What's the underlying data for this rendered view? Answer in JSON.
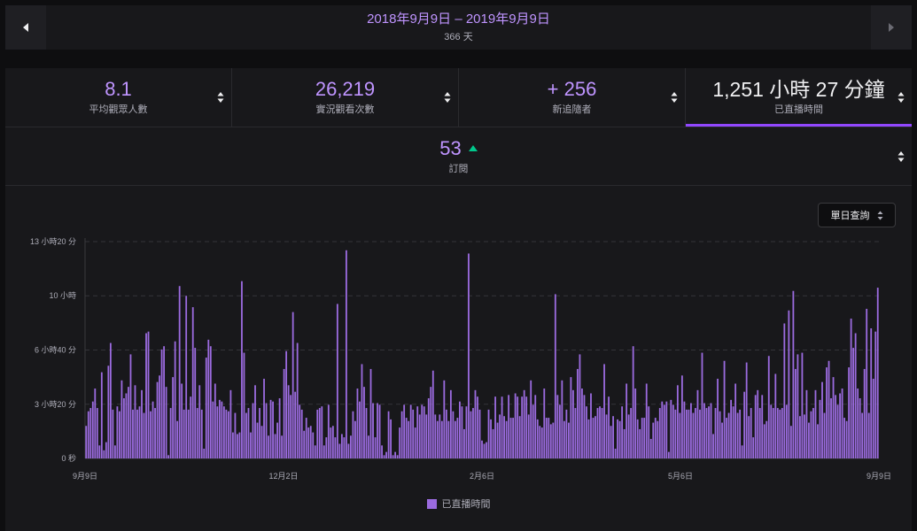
{
  "date_range": {
    "title": "2018年9月9日 – 2019年9月9日",
    "days": "366 天"
  },
  "stats": [
    {
      "value": "8.1",
      "label": "平均觀眾人數"
    },
    {
      "value": "26,219",
      "label": "實況觀看次數"
    },
    {
      "value": "+ 256",
      "label": "新追隨者"
    },
    {
      "value": "1,251 小時 27 分鐘",
      "label": "已直播時間",
      "active": true
    }
  ],
  "subscriptions": {
    "value": "53",
    "label": "訂閱",
    "trend": "up"
  },
  "query_button": {
    "label": "單日查詢"
  },
  "colors": {
    "accent": "#9147ff",
    "bar": "#9b6bdf",
    "value_text": "#bf94ff",
    "trend_up": "#00c88c"
  },
  "chart_data": {
    "type": "bar",
    "title": "",
    "xlabel": "",
    "ylabel": "",
    "x_start": "2018-09-09",
    "x_end": "2019-09-09",
    "x_tick_labels": [
      "9月9日",
      "12月2日",
      "2月6日",
      "5月6日",
      "9月9日"
    ],
    "y_unit": "hours",
    "ylim": [
      0,
      13.333
    ],
    "y_ticks": [
      {
        "value": 0,
        "label": "0 秒"
      },
      {
        "value": 3.333,
        "label": "3 小時20 分"
      },
      {
        "value": 6.667,
        "label": "6 小時40 分"
      },
      {
        "value": 10,
        "label": "10 小時"
      },
      {
        "value": 13.333,
        "label": "13 小時20 分"
      }
    ],
    "grid": true,
    "legend_position": "bottom",
    "series": [
      {
        "name": "已直播時間",
        "values": [
          2.0,
          2.9,
          3.1,
          3.5,
          4.3,
          3.1,
          0.8,
          5.3,
          0.5,
          1.0,
          5.7,
          7.1,
          3.0,
          0.8,
          3.2,
          2.9,
          4.8,
          3.7,
          4.0,
          4.4,
          6.4,
          3.0,
          4.5,
          3.0,
          3.2,
          4.2,
          2.8,
          7.7,
          7.8,
          2.9,
          3.5,
          3.1,
          4.7,
          5.1,
          6.7,
          6.9,
          4.4,
          0.2,
          3.1,
          5.0,
          7.2,
          2.3,
          10.6,
          4.6,
          3.0,
          10.0,
          3.0,
          3.8,
          9.3,
          6.8,
          3.1,
          4.5,
          3.0,
          0.6,
          6.2,
          7.3,
          6.9,
          3.5,
          4.6,
          3.2,
          3.6,
          3.5,
          3.2,
          3.0,
          2.9,
          4.2,
          1.6,
          2.8,
          1.5,
          1.6,
          10.9,
          6.5,
          2.8,
          3.1,
          1.6,
          3.4,
          4.5,
          2.2,
          3.1,
          2.0,
          4.9,
          3.4,
          1.4,
          3.6,
          3.5,
          1.5,
          2.2,
          3.7,
          1.4,
          5.5,
          6.6,
          4.5,
          3.9,
          9.0,
          4.1,
          7.1,
          3.3,
          3.0,
          1.7,
          2.5,
          1.9,
          2.0,
          1.6,
          0.8,
          3.0,
          3.1,
          3.2,
          0.8,
          1.3,
          3.3,
          1.9,
          2.0,
          1.3,
          9.5,
          0.9,
          1.5,
          1.3,
          12.8,
          0.9,
          1.4,
          2.9,
          2.3,
          4.3,
          3.5,
          5.8,
          4.4,
          3.1,
          1.4,
          5.5,
          3.4,
          1.3,
          3.4,
          3.3,
          0.8,
          0.2,
          0.4,
          2.9,
          2.4,
          0.2,
          0.4,
          0.2,
          1.9,
          2.9,
          3.3,
          2.5,
          2.3,
          3.3,
          3.0,
          1.9,
          3.2,
          2.7,
          3.3,
          3.2,
          2.7,
          3.7,
          4.4,
          5.4,
          2.7,
          2.3,
          2.7,
          2.3,
          4.8,
          3.0,
          2.3,
          4.2,
          2.9,
          2.3,
          2.5,
          3.5,
          3.2,
          1.8,
          3.2,
          12.6,
          2.9,
          3.1,
          4.2,
          3.8,
          3.0,
          1.1,
          0.9,
          1.0,
          3.0,
          2.4,
          1.8,
          3.8,
          2.2,
          2.7,
          3.8,
          2.6,
          2.3,
          3.9,
          2.5,
          2.5,
          4.0,
          3.8,
          2.6,
          3.8,
          4.2,
          3.8,
          2.7,
          4.8,
          3.3,
          3.9,
          2.4,
          2.0,
          1.9,
          4.3,
          2.5,
          2.5,
          2.1,
          2.2,
          10.1,
          3.9,
          3.3,
          4.8,
          2.3,
          3.0,
          2.2,
          5.0,
          4.2,
          3.1,
          5.5,
          6.4,
          4.3,
          3.9,
          3.2,
          2.4,
          4.0,
          2.5,
          2.6,
          3.1,
          3.2,
          3.1,
          5.8,
          2.7,
          3.8,
          2.0,
          2.6,
          0.6,
          2.4,
          2.3,
          3.2,
          1.8,
          4.6,
          2.7,
          3.1,
          6.9,
          4.3,
          2.4,
          1.8,
          2.5,
          2.5,
          4.6,
          3.2,
          1.2,
          2.2,
          2.5,
          2.3,
          3.1,
          3.5,
          3.3,
          3.5,
          0.4,
          3.6,
          3.3,
          3.0,
          4.5,
          2.8,
          5.1,
          3.5,
          3.0,
          3.0,
          3.4,
          2.8,
          3.1,
          4.2,
          3.0,
          6.5,
          3.4,
          3.1,
          3.2,
          3.4,
          1.5,
          3.1,
          4.9,
          2.9,
          2.2,
          6.0,
          2.5,
          2.8,
          3.6,
          3.2,
          4.6,
          2.8,
          3.0,
          0.8,
          4.1,
          5.9,
          2.6,
          3.1,
          1.3,
          3.9,
          4.2,
          3.1,
          3.9,
          2.1,
          2.3,
          6.3,
          3.3,
          3.1,
          5.2,
          3.1,
          3.0,
          3.1,
          8.3,
          3.3,
          9.1,
          2.0,
          10.3,
          5.5,
          6.4,
          2.6,
          6.5,
          2.7,
          4.2,
          2.2,
          2.9,
          3.1,
          4.2,
          2.1,
          3.6,
          4.7,
          2.8,
          5.6,
          6.0,
          3.7,
          5.0,
          3.9,
          3.3,
          4.0,
          4.3,
          2.5,
          2.3,
          5.6,
          8.6,
          6.8,
          7.7,
          4.3,
          3.7,
          2.8,
          5.5,
          9.2,
          2.8,
          8.0,
          4.9,
          7.8,
          10.5
        ]
      }
    ]
  }
}
